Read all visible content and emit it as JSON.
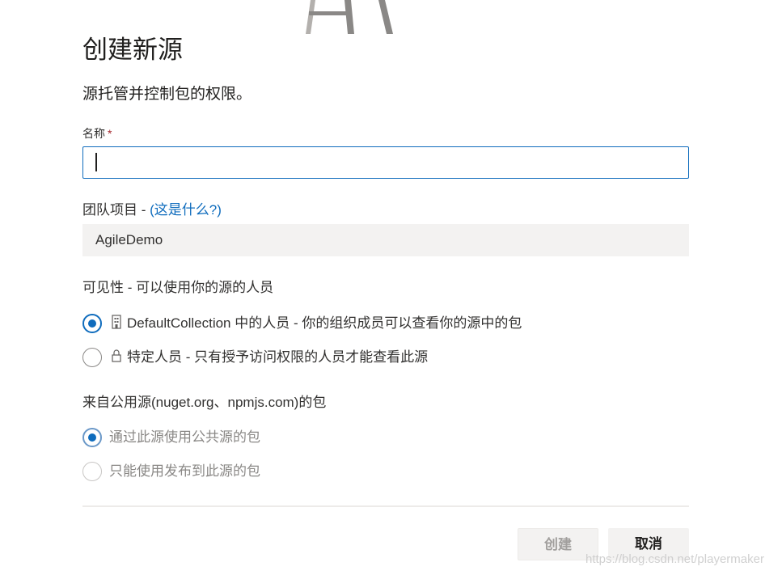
{
  "dialog": {
    "title": "创建新源",
    "subtitle": "源托管并控制包的权限。"
  },
  "name_field": {
    "label": "名称",
    "required_marker": "*",
    "value": ""
  },
  "team_project": {
    "label": "团队项目 - ",
    "help_link": "(这是什么?)",
    "value": "AgileDemo"
  },
  "visibility": {
    "label": "可见性 - 可以使用你的源的人员",
    "options": [
      {
        "icon": "building-icon",
        "title": "DefaultCollection 中的人员",
        "description": " - 你的组织成员可以查看你的源中的包",
        "selected": true
      },
      {
        "icon": "lock-icon",
        "title": "特定人员",
        "description": " - 只有授予访问权限的人员才能查看此源",
        "selected": false
      }
    ]
  },
  "upstream": {
    "label": "来自公用源(nuget.org、npmjs.com)的包",
    "options": [
      {
        "label": "通过此源使用公共源的包",
        "selected": true,
        "disabled": true
      },
      {
        "label": "只能使用发布到此源的包",
        "selected": false,
        "disabled": true
      }
    ]
  },
  "footer": {
    "create_label": "创建",
    "cancel_label": "取消"
  },
  "watermark": "https://blog.csdn.net/playermaker",
  "colors": {
    "accent": "#0f6cbd",
    "required": "#a4262c",
    "readonly_bg": "#f3f2f1"
  }
}
